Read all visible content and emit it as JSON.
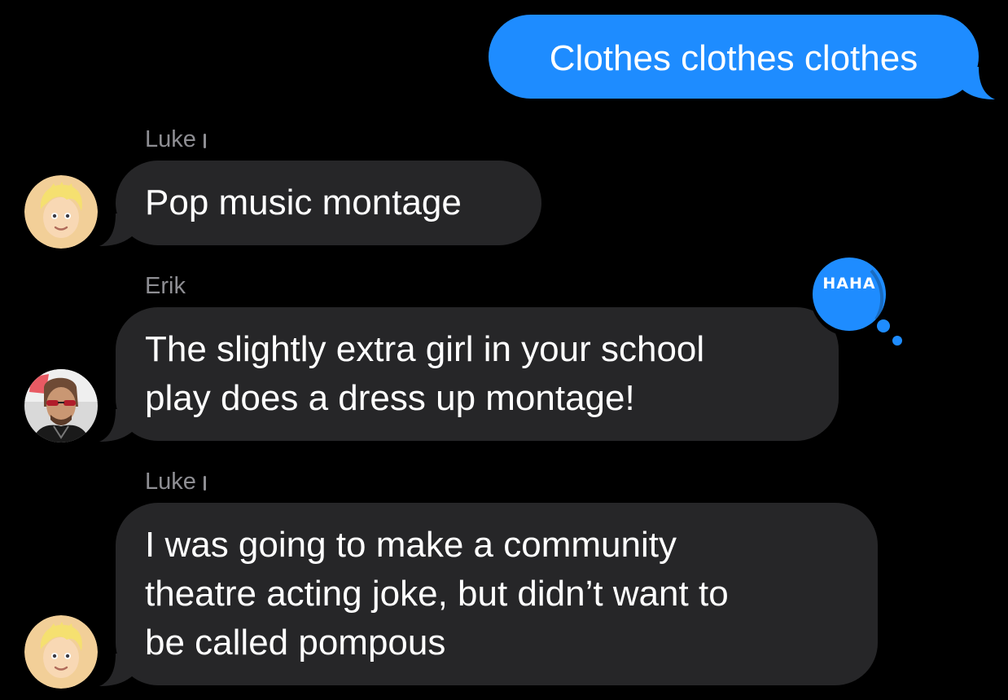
{
  "colors": {
    "background": "#000000",
    "outgoing_bubble": "#1e8cff",
    "incoming_bubble": "#262628",
    "sender_label": "#8e8e93",
    "tapback_blue": "#1e8cff"
  },
  "messages": [
    {
      "direction": "outgoing",
      "text": "Clothes clothes clothes"
    },
    {
      "direction": "incoming",
      "sender": "Luke",
      "avatar": "memoji-blond-avatar",
      "text": "Pop music montage"
    },
    {
      "direction": "incoming",
      "sender": "Erik",
      "avatar": "photo-avatar-sunglasses",
      "text": "The slightly extra girl in your school\nplay does a dress up montage!",
      "tapback": "HAHA"
    },
    {
      "direction": "incoming",
      "sender": "Luke",
      "avatar": "memoji-blond-avatar",
      "text": "I was going to make a community\ntheatre acting joke, but didn’t want to\nbe called pompous"
    }
  ]
}
